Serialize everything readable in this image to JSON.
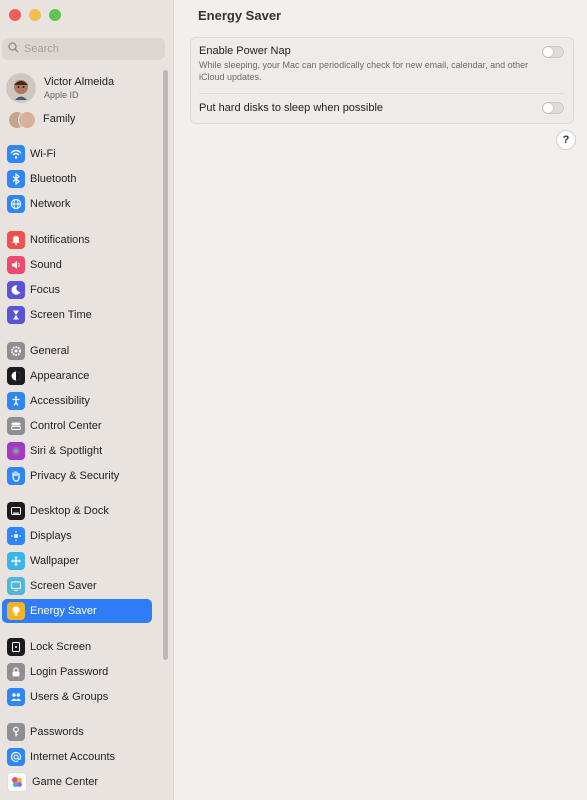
{
  "sidebar": {
    "search_placeholder": "Search",
    "profile": {
      "name": "Victor Almeida",
      "subtitle": "Apple ID"
    },
    "family_label": "Family",
    "items": [
      {
        "label": "Wi-Fi",
        "icon": "wifi-icon",
        "color": "#2f86f6"
      },
      {
        "label": "Bluetooth",
        "icon": "bluetooth-icon",
        "color": "#2f86f6"
      },
      {
        "label": "Network",
        "icon": "globe-icon",
        "color": "#2f86f6"
      },
      {
        "label": "Notifications",
        "icon": "bell-icon",
        "color": "#f0524b"
      },
      {
        "label": "Sound",
        "icon": "speaker-icon",
        "color": "#f04b6f"
      },
      {
        "label": "Focus",
        "icon": "moon-icon",
        "color": "#5b55d6"
      },
      {
        "label": "Screen Time",
        "icon": "hourglass-icon",
        "color": "#5b55d6"
      },
      {
        "label": "General",
        "icon": "gear-icon",
        "color": "#8e8e93"
      },
      {
        "label": "Appearance",
        "icon": "appearance-icon",
        "color": "#1c1c1e"
      },
      {
        "label": "Accessibility",
        "icon": "accessibility-icon",
        "color": "#2f86f6"
      },
      {
        "label": "Control Center",
        "icon": "control-center-icon",
        "color": "#8e8e93"
      },
      {
        "label": "Siri & Spotlight",
        "icon": "siri-icon",
        "color": "#9b3cc9"
      },
      {
        "label": "Privacy & Security",
        "icon": "hand-icon",
        "color": "#2f86f6"
      },
      {
        "label": "Desktop & Dock",
        "icon": "dock-icon",
        "color": "#1c1c1e"
      },
      {
        "label": "Displays",
        "icon": "display-icon",
        "color": "#2f86f6"
      },
      {
        "label": "Wallpaper",
        "icon": "wallpaper-icon",
        "color": "#38b6ea"
      },
      {
        "label": "Screen Saver",
        "icon": "screen-saver-icon",
        "color": "#51b6d9"
      },
      {
        "label": "Energy Saver",
        "icon": "lightbulb-icon",
        "color": "#f5b426"
      },
      {
        "label": "Lock Screen",
        "icon": "lock-screen-icon",
        "color": "#1c1c1e"
      },
      {
        "label": "Login Password",
        "icon": "lock-icon",
        "color": "#8e8e93"
      },
      {
        "label": "Users & Groups",
        "icon": "users-icon",
        "color": "#2f86f6"
      },
      {
        "label": "Passwords",
        "icon": "key-icon",
        "color": "#8e8e93"
      },
      {
        "label": "Internet Accounts",
        "icon": "at-icon",
        "color": "#2f86f6"
      },
      {
        "label": "Game Center",
        "icon": "game-center-icon",
        "color": "#ffffff"
      }
    ],
    "active_item": "Energy Saver"
  },
  "main": {
    "title": "Energy Saver",
    "power_nap": {
      "label": "Enable Power Nap",
      "description": "While sleeping, your Mac can periodically check for new email, calendar, and other iCloud updates.",
      "enabled": false
    },
    "disk_sleep": {
      "label": "Put hard disks to sleep when possible",
      "enabled": false
    },
    "help_label": "?"
  }
}
